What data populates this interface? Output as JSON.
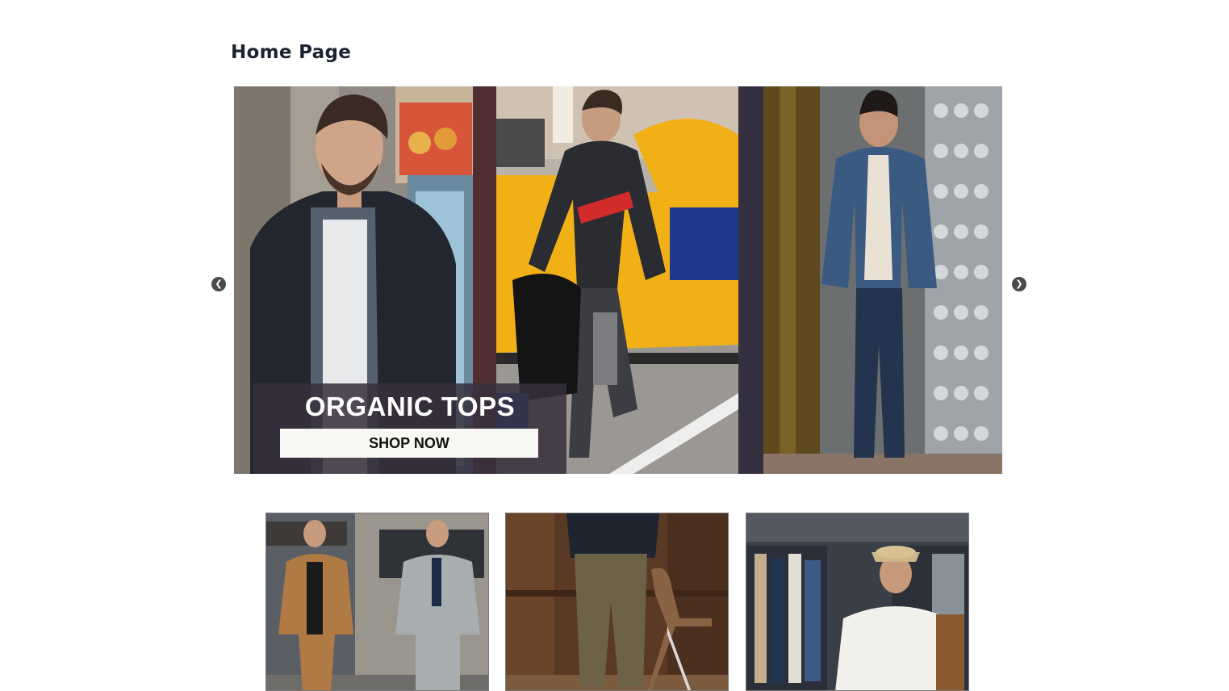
{
  "page": {
    "title": "Home Page"
  },
  "carousel": {
    "promo_title": "ORGANIC TOPS",
    "cta_label": "SHOP NOW",
    "prev_icon": "chevron-left-icon",
    "next_icon": "chevron-right-icon",
    "slides": [
      {
        "image": "man-in-dark-blazer-on-street"
      },
      {
        "image": "man-walking-by-yellow-taxi"
      },
      {
        "image": "man-in-denim-jacket-in-doorway"
      }
    ]
  },
  "categories": [
    {
      "image": "two-men-walking-on-street"
    },
    {
      "image": "man-in-olive-trousers-by-wooden-wall"
    },
    {
      "image": "man-in-hat-browsing-clothing-rack"
    }
  ],
  "colors": {
    "title_text": "#1b2333",
    "promo_overlay": "#37303c",
    "cta_background": "#f7f7f3",
    "arrow": "#4a4a4a"
  }
}
